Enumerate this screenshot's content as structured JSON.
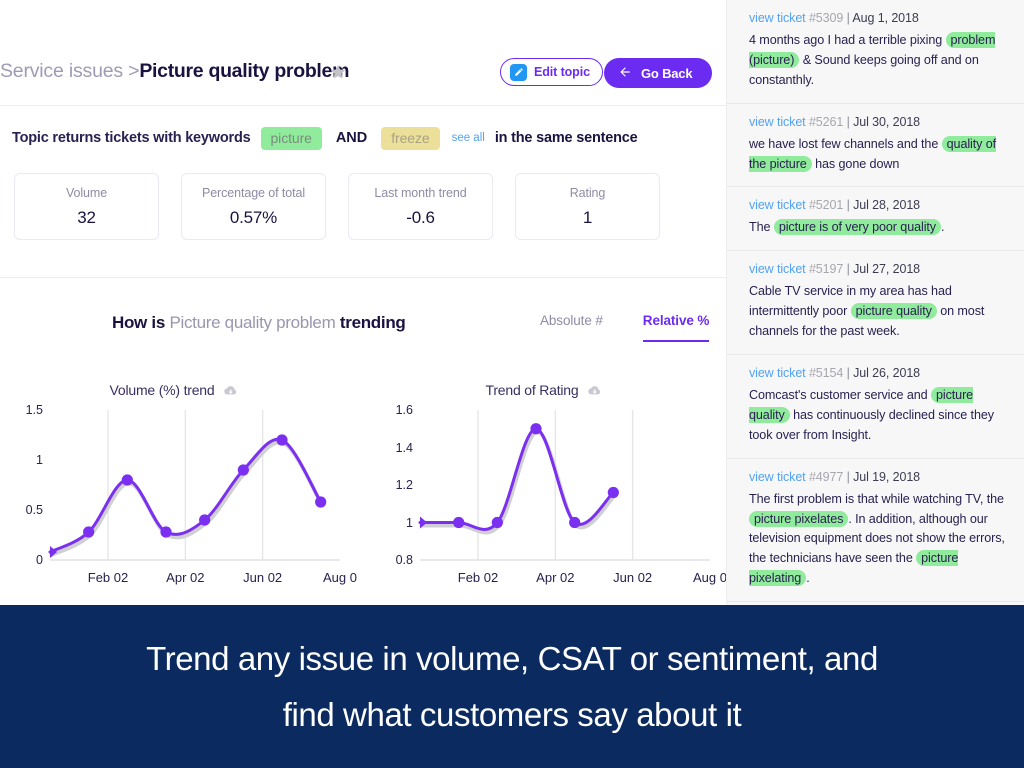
{
  "header": {
    "breadcrumb_parent": "Service issues >",
    "breadcrumb_current": "Picture quality problem",
    "star_icon": "star-icon",
    "edit_button": "Edit topic",
    "edit_icon": "pencil-icon",
    "back_button": "Go Back",
    "back_icon": "arrow-left-icon"
  },
  "rule": {
    "prefix": "Topic returns tickets with keywords",
    "keyword_1": "picture",
    "operator": "AND",
    "keyword_2": "freeze",
    "see_all": "see all",
    "suffix": "in the same sentence"
  },
  "metrics": [
    {
      "label": "Volume",
      "value": "32"
    },
    {
      "label": "Percentage of total",
      "value": "0.57%"
    },
    {
      "label": "Last month trend",
      "value": "-0.6"
    },
    {
      "label": "Rating",
      "value": "1"
    }
  ],
  "trending": {
    "title_prefix": "How is",
    "title_topic": "Picture quality problem",
    "title_suffix": "trending",
    "tabs": [
      {
        "label": "Absolute #",
        "active": false
      },
      {
        "label": "Relative %",
        "active": true
      }
    ]
  },
  "chart_data": [
    {
      "type": "line",
      "title": "Volume (%) trend",
      "download_icon": "cloud-download-icon",
      "xlabel": "",
      "ylabel": "",
      "x": [
        0,
        1,
        2,
        3,
        4,
        5,
        6,
        7
      ],
      "values": [
        0.08,
        0.28,
        0.8,
        0.28,
        0.4,
        0.9,
        1.2,
        0.58
      ],
      "ylim": [
        0,
        1.5
      ],
      "yticks": [
        0,
        0.5,
        1,
        1.5
      ],
      "ytick_labels": [
        "0",
        "0.5",
        "1",
        "1.5"
      ],
      "xtick_labels": [
        "Feb 02",
        "Apr 02",
        "Jun 02",
        "Aug 0"
      ],
      "xtick_positions": [
        1.5,
        3.5,
        5.5,
        7.5
      ],
      "gridlines": [
        1.5,
        3.5,
        5.5
      ],
      "grid": true,
      "line_color": "#7b2ff0",
      "marker_color": "#7b2ff0"
    },
    {
      "type": "line",
      "title": "Trend of Rating",
      "download_icon": "cloud-download-icon",
      "xlabel": "",
      "ylabel": "",
      "x": [
        0,
        1,
        2,
        3,
        4,
        5
      ],
      "values": [
        1.0,
        1.0,
        1.0,
        1.5,
        1.0,
        1.16
      ],
      "ylim": [
        0.8,
        1.6
      ],
      "yticks": [
        0.8,
        1,
        1.2,
        1.4,
        1.6
      ],
      "ytick_labels": [
        "0.8",
        "1",
        "1.2",
        "1.4",
        "1.6"
      ],
      "xtick_labels": [
        "Feb 02",
        "Apr 02",
        "Jun 02",
        "Aug 0"
      ],
      "xtick_positions": [
        1.5,
        3.5,
        5.5,
        7.5
      ],
      "gridlines": [
        1.5,
        3.5,
        5.5
      ],
      "grid": true,
      "line_color": "#7b2ff0",
      "marker_color": "#7b2ff0"
    }
  ],
  "tickets": [
    {
      "link": "view ticket",
      "id": "#5309",
      "date": "Aug 1, 2018",
      "parts": [
        {
          "t": "4 months ago I had a terrible pixing ",
          "h": false
        },
        {
          "t": "problem (picture)",
          "h": true
        },
        {
          "t": " & Sound keeps going off and on constanthly.",
          "h": false
        }
      ]
    },
    {
      "link": "view ticket",
      "id": "#5261",
      "date": "Jul 30, 2018",
      "parts": [
        {
          "t": "we have lost few channels and the ",
          "h": false
        },
        {
          "t": "quality of the picture",
          "h": true
        },
        {
          "t": " has gone down",
          "h": false
        }
      ]
    },
    {
      "link": "view ticket",
      "id": "#5201",
      "date": "Jul 28, 2018",
      "parts": [
        {
          "t": "The ",
          "h": false
        },
        {
          "t": "picture is of very poor quality",
          "h": true
        },
        {
          "t": ".",
          "h": false
        }
      ]
    },
    {
      "link": "view ticket",
      "id": "#5197",
      "date": "Jul 27, 2018",
      "parts": [
        {
          "t": "Cable TV service in my area has had intermittently poor ",
          "h": false
        },
        {
          "t": "picture quality",
          "h": true
        },
        {
          "t": " on most channels for the past week.",
          "h": false
        }
      ]
    },
    {
      "link": "view ticket",
      "id": "#5154",
      "date": "Jul 26, 2018",
      "parts": [
        {
          "t": "Comcast's customer service and ",
          "h": false
        },
        {
          "t": "picture quality",
          "h": true
        },
        {
          "t": " has continuously declined since they took over from Insight.",
          "h": false
        }
      ]
    },
    {
      "link": "view ticket",
      "id": "#4977",
      "date": "Jul 19, 2018",
      "parts": [
        {
          "t": "The first problem is that while watching TV, the ",
          "h": false
        },
        {
          "t": "picture pixelates",
          "h": true
        },
        {
          "t": ". In addition, although our television equipment does not show the errors, the technicians have seen the ",
          "h": false
        },
        {
          "t": "picture pixelating",
          "h": true
        },
        {
          "t": ".",
          "h": false
        }
      ]
    }
  ],
  "caption": {
    "line1": "Trend any issue in volume, CSAT or sentiment, and",
    "line2": "find what customers say about it"
  }
}
